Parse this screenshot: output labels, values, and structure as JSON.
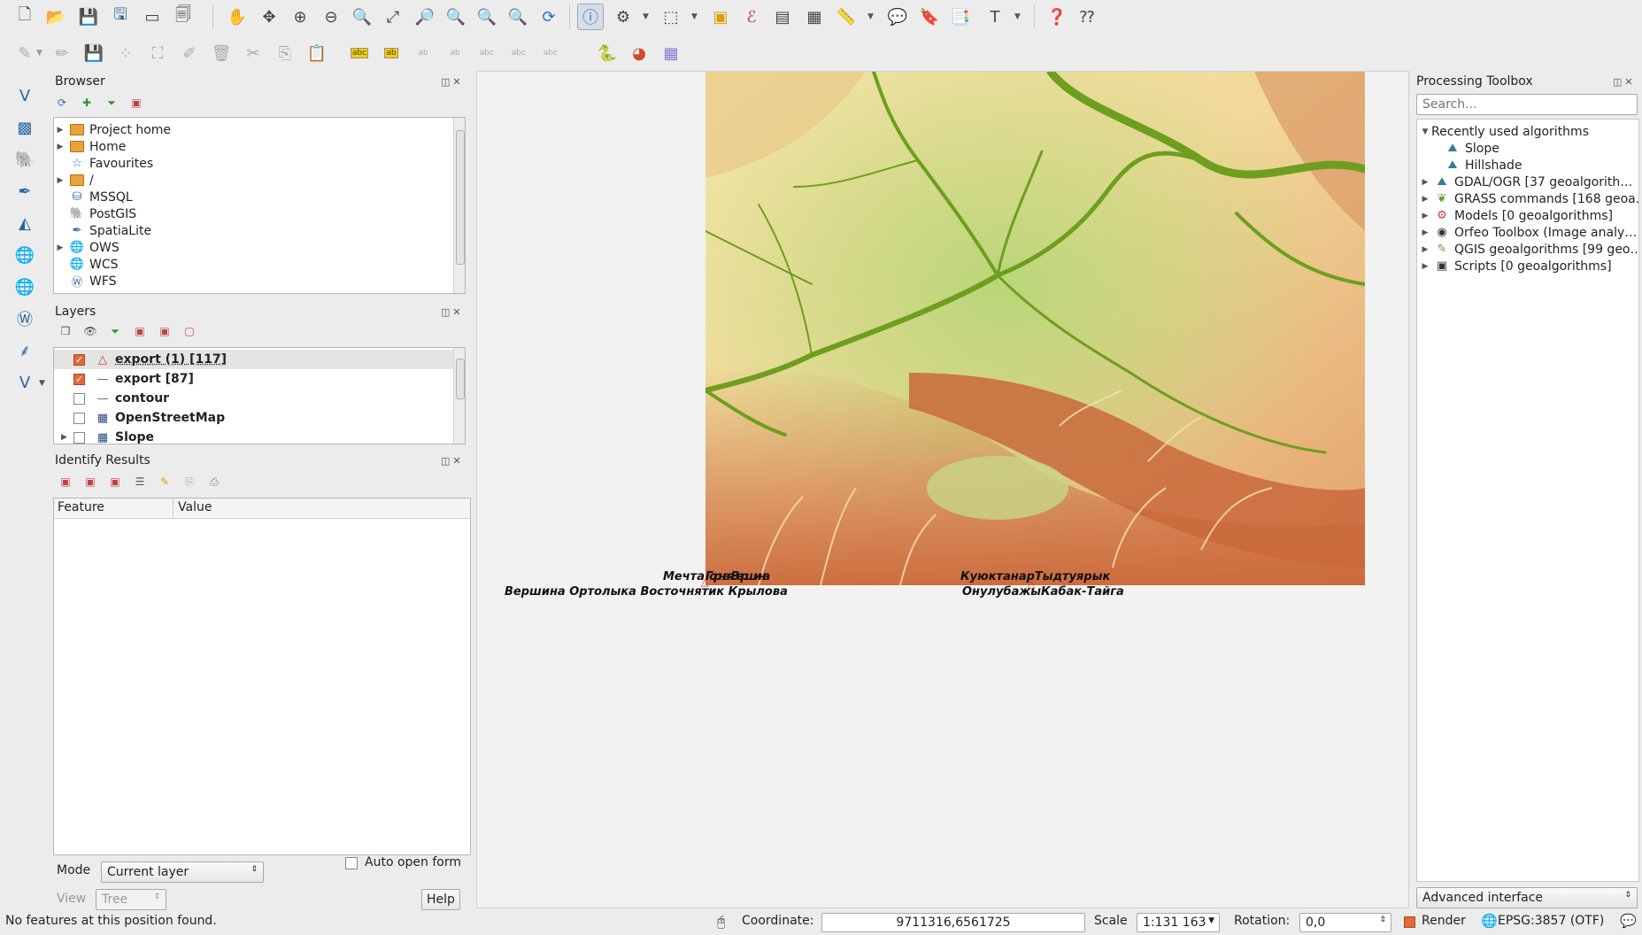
{
  "browser": {
    "title": "Browser",
    "items": [
      {
        "label": "Project home",
        "icon": "folder-icon",
        "expandable": true
      },
      {
        "label": "Home",
        "icon": "folder-icon",
        "expandable": true
      },
      {
        "label": "Favourites",
        "icon": "star-icon",
        "expandable": false
      },
      {
        "label": "/",
        "icon": "folder-icon",
        "expandable": true
      },
      {
        "label": "MSSQL",
        "icon": "mssql-icon",
        "expandable": false
      },
      {
        "label": "PostGIS",
        "icon": "postgis-icon",
        "expandable": false
      },
      {
        "label": "SpatiaLite",
        "icon": "spatialite-icon",
        "expandable": false
      },
      {
        "label": "OWS",
        "icon": "globe-icon",
        "expandable": true
      },
      {
        "label": "WCS",
        "icon": "wcs-icon",
        "expandable": false
      },
      {
        "label": "WFS",
        "icon": "wfs-icon",
        "expandable": false
      }
    ]
  },
  "layers": {
    "title": "Layers",
    "items": [
      {
        "label": "export (1) [117]",
        "checked": true,
        "icon": "triangle-icon",
        "selected": true
      },
      {
        "label": "export [87]",
        "checked": true,
        "icon": "line-icon",
        "selected": false
      },
      {
        "label": "contour",
        "checked": false,
        "icon": "line-icon",
        "selected": false
      },
      {
        "label": "OpenStreetMap",
        "checked": false,
        "icon": "raster-icon",
        "selected": false
      },
      {
        "label": "Slope",
        "checked": false,
        "icon": "raster-icon",
        "selected": false
      }
    ]
  },
  "identify": {
    "title": "Identify Results",
    "col_feature": "Feature",
    "col_value": "Value",
    "mode_label": "Mode",
    "mode_value": "Current layer",
    "auto_open_label": "Auto open form",
    "view_label": "View",
    "view_value": "Tree",
    "help_label": "Help"
  },
  "map": {
    "labels_row1_left": "Мечта",
    "labels_row1_left_overlap": "ГорнаяВершина",
    "labels_row2_left": "Вершина Ортолыка Восточнятик Крылова",
    "labels_row1_right": "КуюктанарТыдтуярык",
    "labels_row2_right": "ОнулубажыКабак-Тайга"
  },
  "toolbox": {
    "title": "Processing Toolbox",
    "search_placeholder": "Search...",
    "recent_label": "Recently used algorithms",
    "recent_items": [
      "Slope",
      "Hillshade"
    ],
    "groups": [
      "GDAL/OGR [37 geoalgorith…",
      "GRASS commands [168 geoa…",
      "Models [0 geoalgorithms]",
      "Orfeo Toolbox (Image analy…",
      "QGIS geoalgorithms [99 geo…",
      "Scripts [0 geoalgorithms]"
    ],
    "interface_label": "Advanced interface"
  },
  "status": {
    "message": "No features at this position found.",
    "coordinate_label": "Coordinate:",
    "coordinate_value": "9711316,6561725",
    "scale_label": "Scale",
    "scale_value": "1:131 163",
    "rotation_label": "Rotation:",
    "rotation_value": "0,0",
    "render_label": "Render",
    "crs_label": "EPSG:3857 (OTF)"
  }
}
